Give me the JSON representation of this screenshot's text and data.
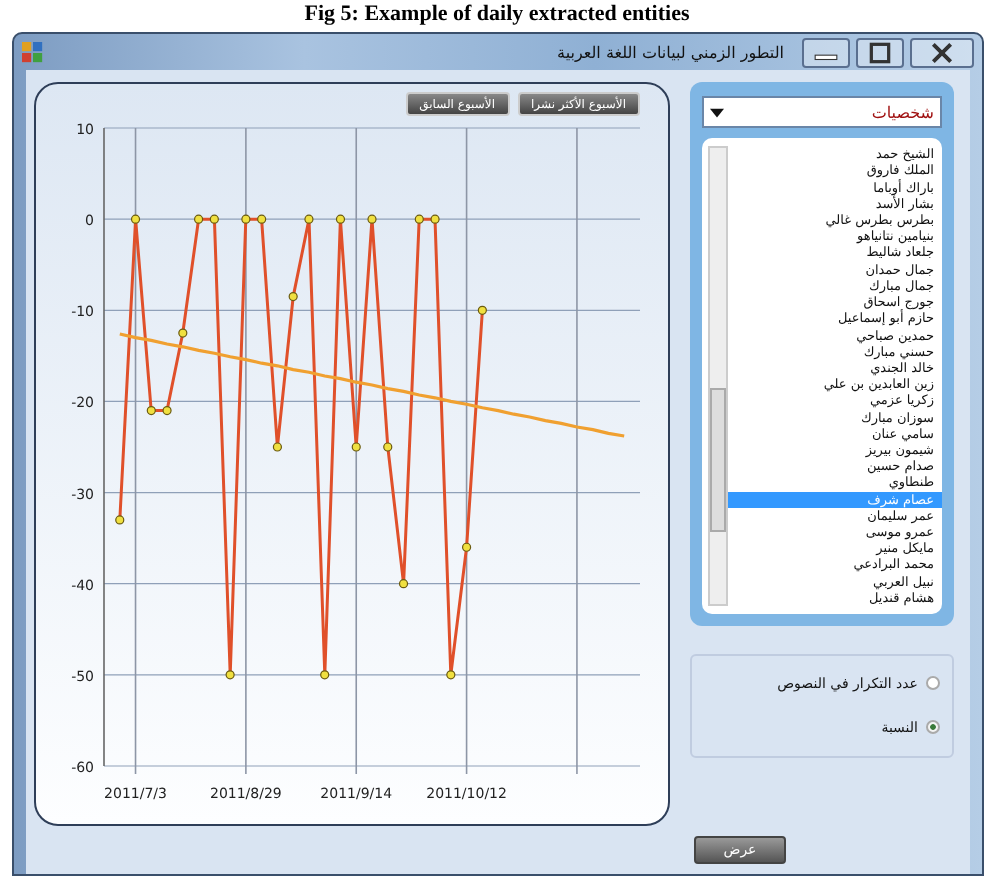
{
  "caption": "Fig 5: Example of daily extracted entities",
  "window": {
    "title": "التطور الزمني لبيانات اللغة العربية"
  },
  "chart_panel": {
    "buttons": [
      {
        "label": "الأسبوع الأكثر نشرا"
      },
      {
        "label": "الأسبوع السابق"
      }
    ],
    "chart_data": {
      "type": "line",
      "categories": [
        null,
        "2011/7/3",
        null,
        null,
        null,
        null,
        null,
        null,
        "2011/8/29",
        null,
        null,
        null,
        null,
        null,
        null,
        "2011/9/14",
        null,
        null,
        null,
        null,
        null,
        null,
        "2011/10/12",
        null,
        null,
        null,
        null,
        null,
        null,
        null,
        null,
        null,
        null
      ],
      "series": [
        {
          "color": "#e0502a",
          "marker": true,
          "values": [
            -33,
            0,
            -21,
            -21,
            -12.5,
            0,
            0,
            -50,
            0,
            0,
            -25,
            -8.5,
            0,
            -50,
            0,
            -25,
            0,
            -25,
            -40,
            0,
            0,
            -50,
            -36,
            -10,
            null,
            null,
            null,
            null,
            null,
            null,
            null,
            null,
            null
          ]
        },
        {
          "color": "#f0a030",
          "marker": false,
          "values": [
            -12.6,
            -13,
            -13.3,
            -13.7,
            -14,
            -14.4,
            -14.7,
            -15.1,
            -15.4,
            -15.8,
            -16.1,
            -16.5,
            -16.8,
            -17.2,
            -17.5,
            -17.9,
            -18.2,
            -18.6,
            -18.9,
            -19.3,
            -19.6,
            -20,
            -20.3,
            -20.7,
            -21,
            -21.4,
            -21.7,
            -22.1,
            -22.4,
            -22.8,
            -23.1,
            -23.5,
            -23.8
          ]
        }
      ],
      "grid": true,
      "ylim": [
        -60,
        10
      ],
      "yticks": [
        10,
        0,
        -10,
        -20,
        -30,
        -40,
        -50,
        -60
      ]
    }
  },
  "side_panel": {
    "dropdown": {
      "value": "شخصيات"
    },
    "list": [
      {
        "label": "الشيخ حمد",
        "selected": false
      },
      {
        "label": "الملك فاروق",
        "selected": false
      },
      {
        "label": "باراك أوباما",
        "selected": false
      },
      {
        "label": "بشار الأسد",
        "selected": false
      },
      {
        "label": "بطرس بطرس غالي",
        "selected": false
      },
      {
        "label": "بنيامين نتانياهو",
        "selected": false
      },
      {
        "label": "جلعاد شاليط",
        "selected": false
      },
      {
        "label": "جمال حمدان",
        "selected": false
      },
      {
        "label": "جمال مبارك",
        "selected": false
      },
      {
        "label": "جورج اسحاق",
        "selected": false
      },
      {
        "label": "حازم أبو إسماعيل",
        "selected": false
      },
      {
        "label": "حمدين صباحي",
        "selected": false
      },
      {
        "label": "حسني مبارك",
        "selected": false
      },
      {
        "label": "خالد الجندي",
        "selected": false
      },
      {
        "label": "زين العابدين بن علي",
        "selected": false
      },
      {
        "label": "زكريا عزمي",
        "selected": false
      },
      {
        "label": "سوزان مبارك",
        "selected": false
      },
      {
        "label": "سامي عنان",
        "selected": false
      },
      {
        "label": "شيمون بيريز",
        "selected": false
      },
      {
        "label": "صدام حسين",
        "selected": false
      },
      {
        "label": "طنطاوي",
        "selected": false
      },
      {
        "label": "عصام شرف",
        "selected": true
      },
      {
        "label": "عمر سليمان",
        "selected": false
      },
      {
        "label": "عمرو موسى",
        "selected": false
      },
      {
        "label": "مايكل منير",
        "selected": false
      },
      {
        "label": "محمد البرادعي",
        "selected": false
      },
      {
        "label": "نبيل العربي",
        "selected": false
      },
      {
        "label": "هشام قنديل",
        "selected": false
      }
    ],
    "options": [
      {
        "label": "عدد التكرار في النصوص",
        "selected": false
      },
      {
        "label": "النسبة",
        "selected": true
      }
    ]
  },
  "show_button": {
    "label": "عرض"
  }
}
